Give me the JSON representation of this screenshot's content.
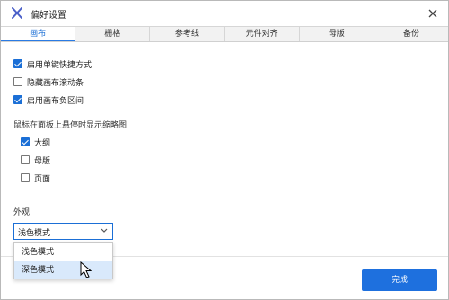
{
  "window": {
    "title": "偏好设置",
    "accent_color": "#1b6fd6",
    "logo_icon": "x-logo-icon",
    "close_icon": "close-icon"
  },
  "tabs": [
    {
      "label": "画布",
      "active": true
    },
    {
      "label": "栅格",
      "active": false
    },
    {
      "label": "参考线",
      "active": false
    },
    {
      "label": "元件对齐",
      "active": false
    },
    {
      "label": "母版",
      "active": false
    },
    {
      "label": "备份",
      "active": false
    }
  ],
  "canvas_options": [
    {
      "label": "启用单键快捷方式",
      "checked": true
    },
    {
      "label": "隐藏画布滚动条",
      "checked": false
    },
    {
      "label": "启用画布负区间",
      "checked": true
    }
  ],
  "thumbnail_section": {
    "title": "鼠标在面板上悬停时显示缩略图",
    "items": [
      {
        "label": "大纲",
        "checked": true
      },
      {
        "label": "母版",
        "checked": false
      },
      {
        "label": "页面",
        "checked": false
      }
    ]
  },
  "appearance": {
    "title": "外观",
    "selected": "浅色模式",
    "options": [
      "浅色模式",
      "深色模式"
    ],
    "hovered_option": "深色模式"
  },
  "footer": {
    "done_label": "完成"
  }
}
